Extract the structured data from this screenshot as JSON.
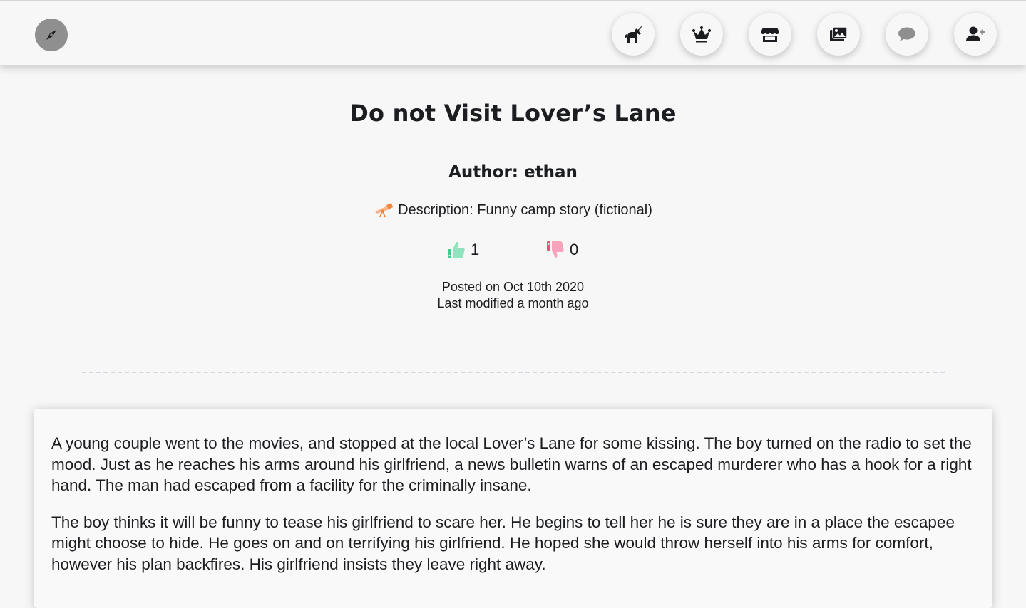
{
  "nav": {
    "logo_icon": "compass-icon",
    "buttons": [
      {
        "icon": "unicorn-icon"
      },
      {
        "icon": "crown-icon"
      },
      {
        "icon": "store-icon"
      },
      {
        "icon": "images-icon"
      },
      {
        "icon": "comment-icon"
      },
      {
        "icon": "user-plus-icon"
      }
    ]
  },
  "post": {
    "title": "Do not Visit Lover’s Lane",
    "author": "Author: ethan",
    "description_icon": "telescope-icon",
    "description": "Description: Funny camp story (fictional)",
    "likes": "1",
    "dislikes": "0",
    "posted": "Posted on Oct 10th 2020",
    "modified": "Last modified a month ago",
    "paragraphs": [
      "A young couple went to the movies, and stopped at the local Lover’s Lane for some kissing. The boy turned on the radio to set the mood. Just as he reaches his arms around his girlfriend, a news bulletin warns of an escaped murderer who has a hook for a right hand. The man had escaped from a facility for the criminally insane.",
      "The boy thinks it will be funny to tease his girlfriend to scare her. He begins to tell her he is sure they are in a place the escapee might choose to hide. He goes on and on terrifying his girlfriend. He hoped she would throw herself into his arms for comfort, however his plan backfires. His girlfriend insists they leave right away."
    ]
  },
  "colors": {
    "like": "#3ecf8e",
    "dislike": "#f0507a",
    "telescope": "#f5843a"
  }
}
